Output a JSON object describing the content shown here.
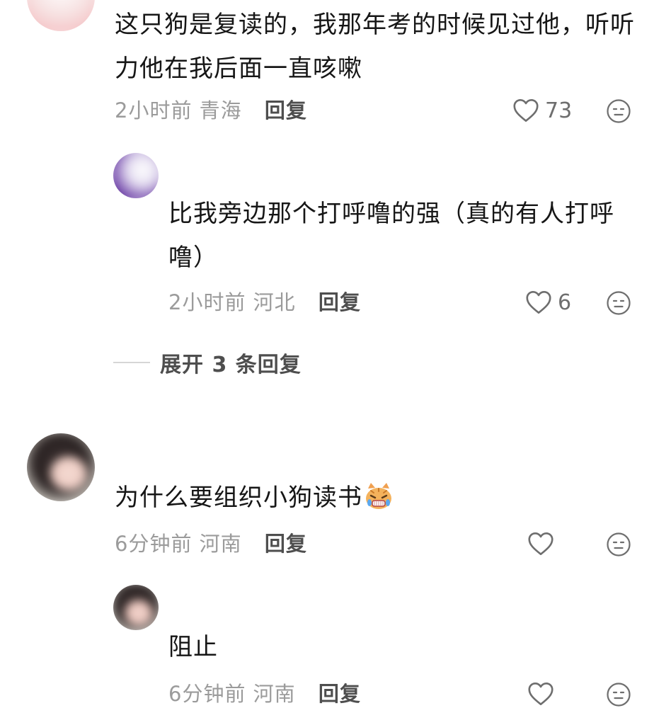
{
  "comments": [
    {
      "text": "这只狗是复读的，我那年考的时候见过他，听听力他在我后面一直咳嗽",
      "time": "2小时前",
      "location": "青海",
      "reply_label": "回复",
      "likes": "73",
      "replies": [
        {
          "text": "比我旁边那个打呼噜的强（真的有人打呼噜）",
          "time": "2小时前",
          "location": "河北",
          "reply_label": "回复",
          "likes": "6"
        }
      ],
      "expand_label": "展开 3 条回复"
    },
    {
      "text": "为什么要组织小狗读书",
      "emoji": "crying-cat-emoji",
      "time": "6分钟前",
      "location": "河南",
      "reply_label": "回复",
      "likes": "",
      "replies": [
        {
          "text": "阻止",
          "time": "6分钟前",
          "location": "河南",
          "reply_label": "回复",
          "likes": ""
        }
      ]
    }
  ],
  "colors": {
    "text": "#161616",
    "meta": "#9b9b9b",
    "reply": "#4e4e4e",
    "icon": "#6e6e6e"
  },
  "icons": [
    "heart-icon",
    "dislike-face-icon"
  ]
}
